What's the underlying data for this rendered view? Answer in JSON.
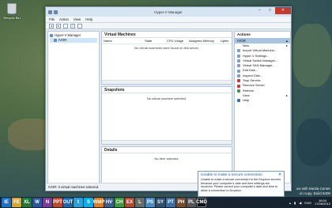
{
  "desktop": {
    "recycle_bin_label": "Recycle Bin",
    "watermark_line1": "ow with Media Center",
    "watermark_line2": "on copy. Build 8400"
  },
  "window": {
    "title": "Hyper-V Manager",
    "min": "–",
    "max": "□",
    "close": "✕"
  },
  "menu": [
    "File",
    "Action",
    "View",
    "Help"
  ],
  "tree": {
    "root": "Hyper-V Manager",
    "node": "IVOR"
  },
  "vm_pane": {
    "title": "Virtual Machines",
    "columns": [
      "Name",
      "State",
      "CPU Usage",
      "Assigned Memory",
      "Uptim"
    ],
    "message": "No virtual machines were found on this server."
  },
  "snap_pane": {
    "title": "Snapshots",
    "message": "No virtual machine selected."
  },
  "details_pane": {
    "title": "Details",
    "message": "No item selected."
  },
  "actions": {
    "header": "Actions",
    "section": "IVOR",
    "items": [
      "New",
      "Import Virtual Machine...",
      "Hyper-V Settings...",
      "Virtual Switch Manager...",
      "Virtual SAN Manager...",
      "Edit Disk...",
      "Inspect Disk...",
      "Stop Service",
      "Remove Server",
      "Refresh",
      "View",
      "Help"
    ]
  },
  "status": "IVOR:  0 virtual machines selected.",
  "toast": {
    "title": "Unable to make a secure connection",
    "close": "✕",
    "body": "Unable to make a secure connection to the Dropbox servers because your computer's date and time settings are incorrect. Please correct your computer's date and time to allow a connection to Dropbox."
  },
  "taskbar": {
    "apps": [
      "IE",
      "FE",
      "XL",
      "W",
      "N",
      "PPT",
      "OUT",
      "t",
      "S",
      "WMP",
      "HV",
      "CH",
      "EX",
      "L",
      "PS",
      "SY",
      "PT",
      "PH",
      "PL",
      "CMD"
    ],
    "lang": "ENG",
    "time": "16:04",
    "date": "17/06/2012"
  },
  "colors": {
    "accent": "#1f5fa0",
    "close": "#c7392f",
    "selection": "#a9c4df"
  }
}
